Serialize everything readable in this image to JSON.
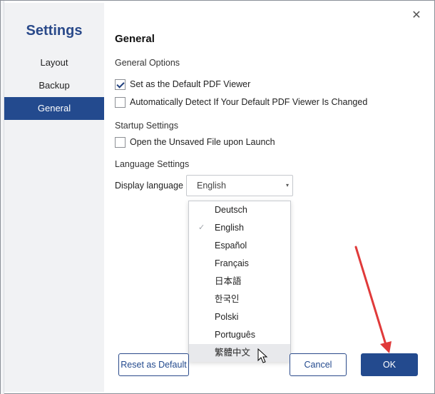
{
  "sidebar": {
    "title": "Settings",
    "items": [
      {
        "label": "Layout"
      },
      {
        "label": "Backup"
      },
      {
        "label": "General"
      }
    ]
  },
  "window": {
    "close_symbol": "✕"
  },
  "main": {
    "title": "General",
    "general_options": {
      "heading": "General Options",
      "items": [
        {
          "label": "Set as the Default PDF Viewer",
          "checked": true
        },
        {
          "label": "Automatically Detect If Your Default PDF Viewer Is Changed",
          "checked": false
        }
      ]
    },
    "startup": {
      "heading": "Startup Settings",
      "items": [
        {
          "label": "Open the Unsaved File upon Launch",
          "checked": false
        }
      ]
    },
    "language": {
      "heading": "Language Settings",
      "label": "Display language",
      "selected": "English",
      "caret_symbol": "▾",
      "options": [
        {
          "label": "Deutsch"
        },
        {
          "label": "English",
          "checkmark": "✓"
        },
        {
          "label": "Español"
        },
        {
          "label": "Français"
        },
        {
          "label": "日本語"
        },
        {
          "label": "한국인"
        },
        {
          "label": "Polski"
        },
        {
          "label": "Português"
        },
        {
          "label": "繁體中文"
        }
      ]
    }
  },
  "footer": {
    "reset_label": "Reset as Default",
    "cancel_label": "Cancel",
    "ok_label": "OK"
  },
  "colors": {
    "accent": "#234a8e",
    "annotation_arrow": "#e03a3a"
  }
}
